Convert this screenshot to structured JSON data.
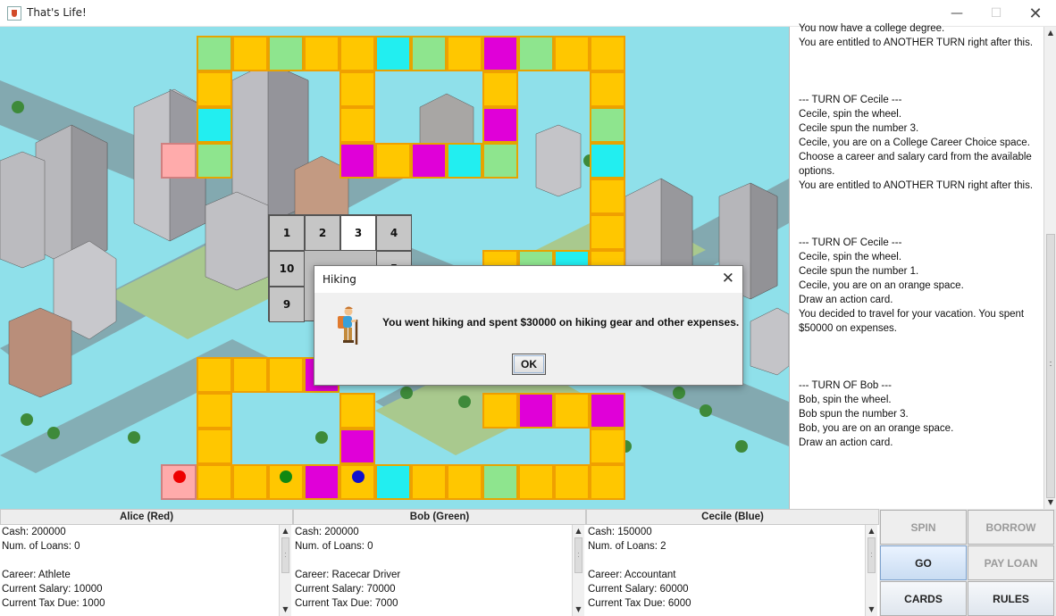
{
  "window": {
    "title": "That's Life!",
    "min_icon": "minimize-icon",
    "max_icon": "maximize-icon",
    "close_icon": "close-icon"
  },
  "wheel": {
    "numbers": [
      "1",
      "2",
      "3",
      "4",
      "10",
      "5",
      "9"
    ],
    "selected": "3"
  },
  "log": {
    "lines": "You now have a college degree.\nYou are entitled to ANOTHER TURN right after this.\n\n\n\n--- TURN OF Cecile ---\nCecile, spin the wheel.\nCecile spun the number 3.\nCecile, you are on a College Career Choice space.\nChoose a career and salary card from the available options.\nYou are entitled to ANOTHER TURN right after this.\n\n\n\n--- TURN OF Cecile ---\nCecile, spin the wheel.\nCecile spun the number 1.\nCecile, you are on an orange space.\nDraw an action card.\nYou decided to travel for your vacation. You spent $50000 on expenses.\n\n\n\n--- TURN OF Bob ---\nBob, spin the wheel.\nBob spun the number 3.\nBob, you are on an orange space.\nDraw an action card."
  },
  "players": [
    {
      "header": "Alice (Red)",
      "lines": "Cash: 200000\nNum. of Loans: 0\n\nCareer: Athlete\nCurrent Salary: 10000\nCurrent Tax Due: 1000"
    },
    {
      "header": "Bob (Green)",
      "lines": "Cash: 200000\nNum. of Loans: 0\n\nCareer: Racecar Driver\nCurrent Salary: 70000\nCurrent Tax Due: 7000"
    },
    {
      "header": "Cecile (Blue)",
      "lines": "Cash: 150000\nNum. of Loans: 2\n\nCareer: Accountant\nCurrent Salary: 60000\nCurrent Tax Due: 6000"
    }
  ],
  "actions": {
    "spin": "SPIN",
    "borrow": "BORROW",
    "go": "GO",
    "pay_loan": "PAY LOAN",
    "cards": "CARDS",
    "rules": "RULES"
  },
  "dialog": {
    "title": "Hiking",
    "message": "You went hiking and spent $30000 on hiking gear and other expenses.",
    "ok": "OK",
    "icon": "hiker-icon"
  },
  "colors": {
    "yellow_space": "#ffc700",
    "green_space": "#8ee58e",
    "cyan_space": "#22eef0",
    "magenta_space": "#e000d8",
    "pink_space": "#ffabab",
    "alice_token": "#ee0000",
    "bob_token": "#118811",
    "cecile_token": "#1010cc",
    "board_background": "#8fe0ea"
  }
}
